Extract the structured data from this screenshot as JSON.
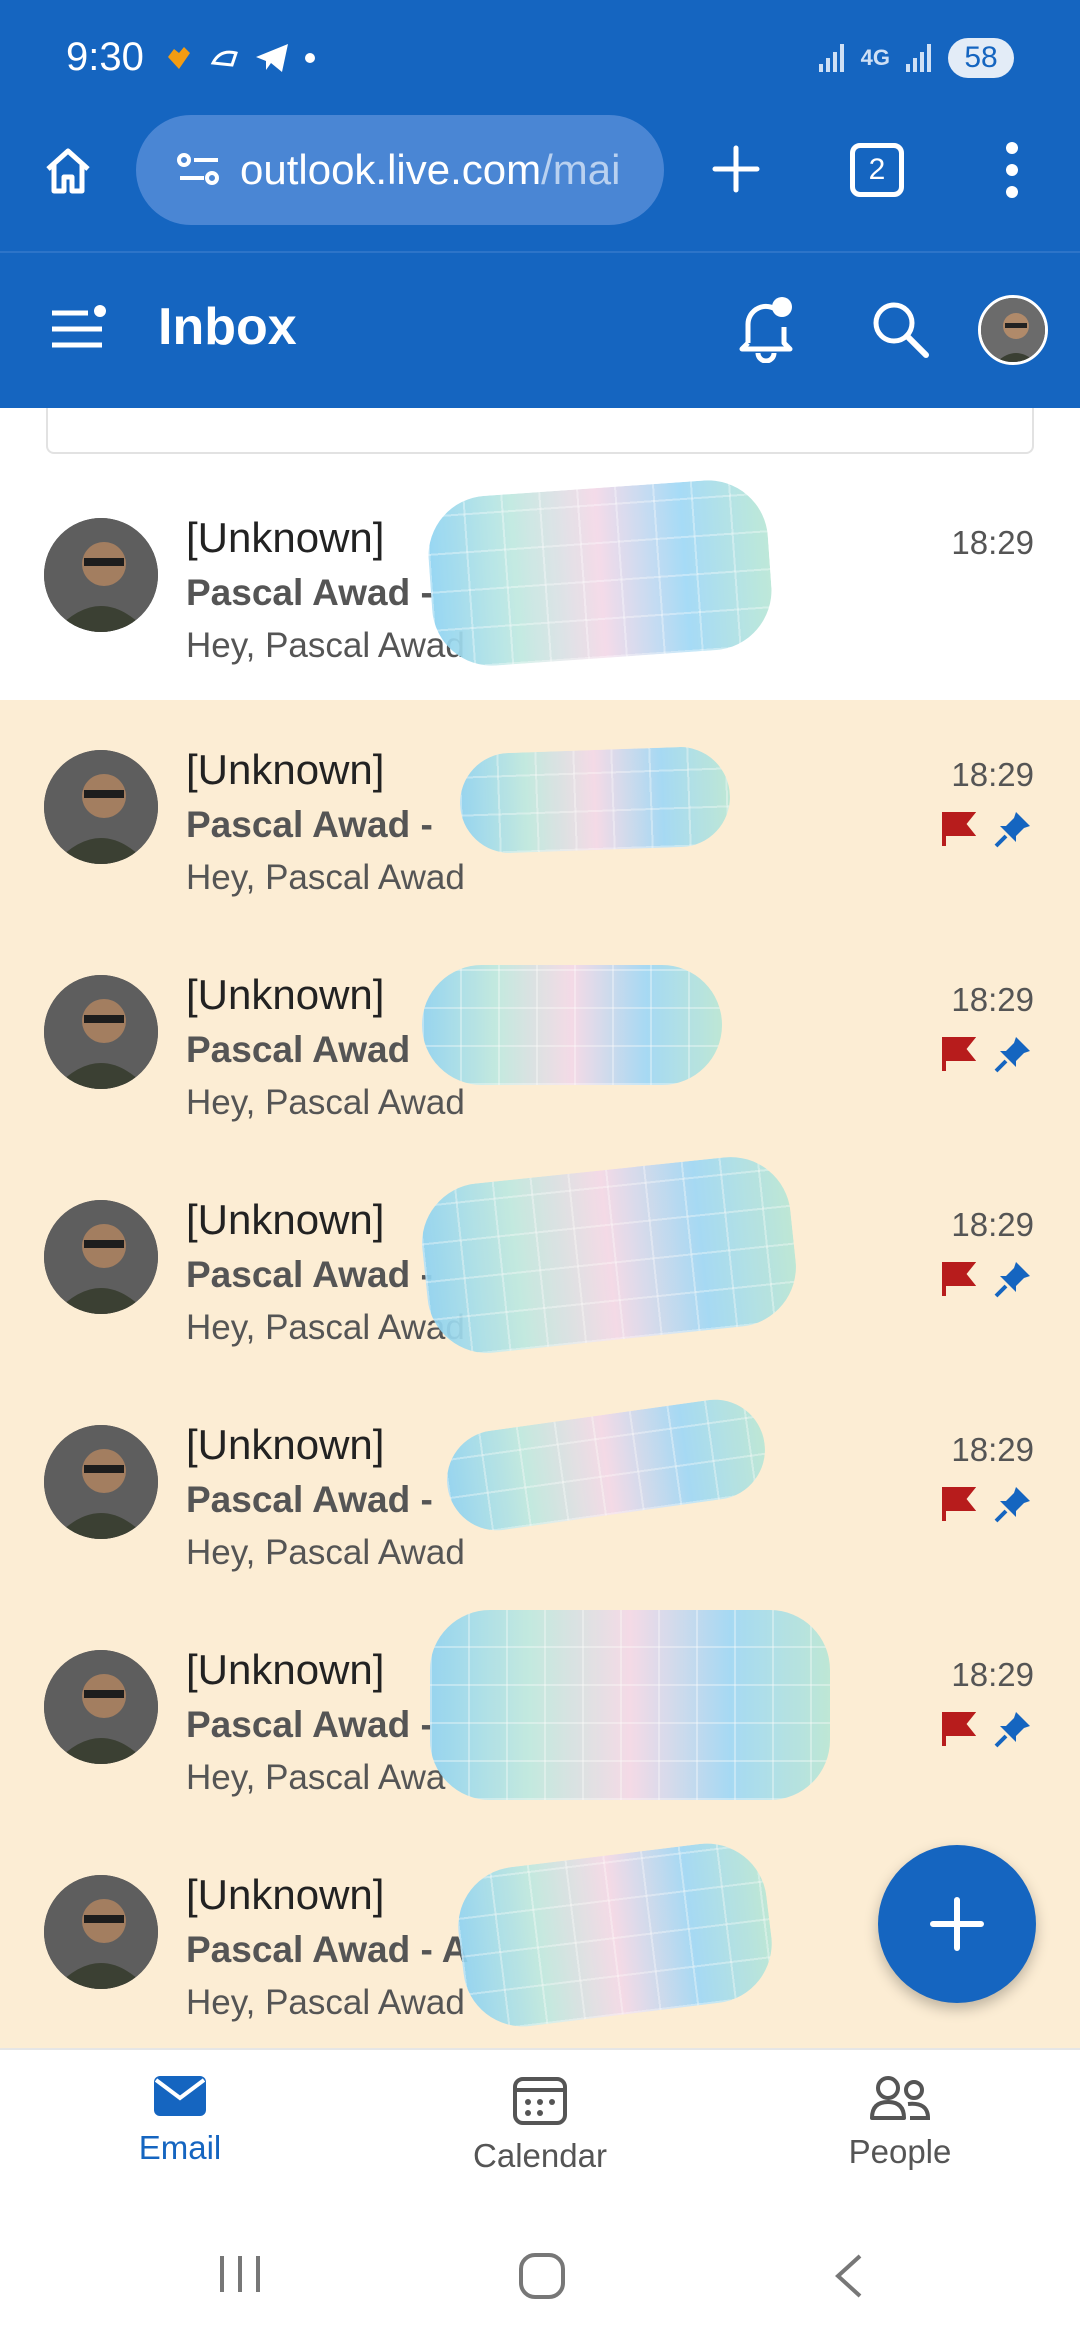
{
  "status_bar": {
    "time": "9:30",
    "network": "4G",
    "battery": "58"
  },
  "browser": {
    "url_main": "outlook.live.com",
    "url_rest": "/mai",
    "tab_count": "2"
  },
  "app": {
    "title": "Inbox"
  },
  "messages": [
    {
      "sender": "[Unknown]",
      "subject": "Pascal Awad - ",
      "preview": "Hey, Pascal Awad",
      "time": "18:29",
      "flagged": false,
      "pinned": false
    },
    {
      "sender": "[Unknown]",
      "subject": "Pascal Awad - ",
      "preview": "Hey, Pascal Awad",
      "time": "18:29",
      "flagged": true,
      "pinned": true
    },
    {
      "sender": "[Unknown]",
      "subject": "Pascal Awad",
      "preview": "Hey, Pascal Awad",
      "time": "18:29",
      "flagged": true,
      "pinned": true
    },
    {
      "sender": "[Unknown]",
      "subject": "Pascal Awad - ",
      "preview": "Hey, Pascal Awad",
      "time": "18:29",
      "flagged": true,
      "pinned": true
    },
    {
      "sender": "[Unknown]",
      "subject": "Pascal Awad - ",
      "preview": "Hey, Pascal Awad",
      "time": "18:29",
      "flagged": true,
      "pinned": true
    },
    {
      "sender": "[Unknown]",
      "subject": "Pascal Awad - ",
      "preview": "Hey, Pascal Awa",
      "time": "18:29",
      "flagged": true,
      "pinned": true
    },
    {
      "sender": "[Unknown]",
      "subject": "Pascal Awad - A",
      "preview": "Hey, Pascal Awad",
      "time": "",
      "flagged": false,
      "pinned": false
    }
  ],
  "bottom_nav": {
    "email": "Email",
    "calendar": "Calendar",
    "people": "People"
  },
  "colors": {
    "brand": "#1565c0",
    "pinned_row": "#fcedd4",
    "flag": "#b71c1c"
  }
}
